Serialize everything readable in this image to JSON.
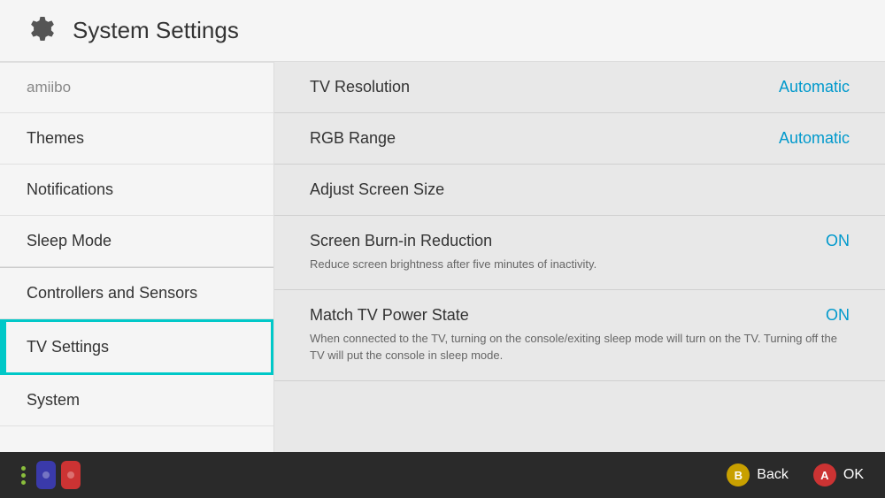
{
  "header": {
    "title": "System Settings",
    "icon_label": "gear-icon"
  },
  "sidebar": {
    "items": [
      {
        "id": "amiibo",
        "label": "amiibo",
        "active": false,
        "dimmed": true
      },
      {
        "id": "themes",
        "label": "Themes",
        "active": false,
        "dimmed": false
      },
      {
        "id": "notifications",
        "label": "Notifications",
        "active": false,
        "dimmed": false
      },
      {
        "id": "sleep-mode",
        "label": "Sleep Mode",
        "active": false,
        "dimmed": false
      },
      {
        "id": "controllers-sensors",
        "label": "Controllers and Sensors",
        "active": false,
        "dimmed": false
      },
      {
        "id": "tv-settings",
        "label": "TV Settings",
        "active": true,
        "dimmed": false
      },
      {
        "id": "system",
        "label": "System",
        "active": false,
        "dimmed": false
      }
    ]
  },
  "content": {
    "settings": [
      {
        "id": "tv-resolution",
        "label": "TV Resolution",
        "value": "Automatic",
        "description": null
      },
      {
        "id": "rgb-range",
        "label": "RGB Range",
        "value": "Automatic",
        "description": null
      },
      {
        "id": "adjust-screen-size",
        "label": "Adjust Screen Size",
        "value": null,
        "description": null
      },
      {
        "id": "screen-burn-in-reduction",
        "label": "Screen Burn-in Reduction",
        "value": "ON",
        "description": "Reduce screen brightness after five minutes of inactivity."
      },
      {
        "id": "match-tv-power-state",
        "label": "Match TV Power State",
        "value": "ON",
        "description": "When connected to the TV, turning on the console/exiting sleep mode will turn on the TV. Turning off the TV will put the console in sleep mode."
      }
    ]
  },
  "footer": {
    "back_label": "Back",
    "ok_label": "OK",
    "b_button": "B",
    "a_button": "A"
  },
  "colors": {
    "accent": "#00c8c8",
    "value_color": "#0099cc",
    "on_color": "#0099cc"
  }
}
